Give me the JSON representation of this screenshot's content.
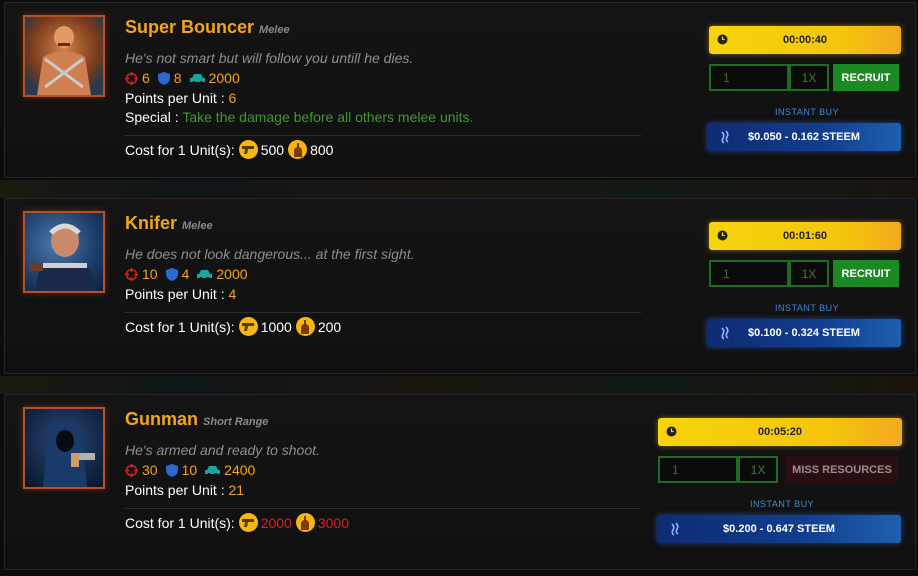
{
  "labels": {
    "points_per_unit": "Points per Unit :",
    "special": "Special :",
    "cost_for": "Cost for 1 Unit(s):",
    "instant_buy": "INSTANT BUY",
    "recruit": "RECRUIT",
    "miss_resources": "MISS RESOURCES",
    "quantity_placeholder": "1",
    "multiplier": "1X"
  },
  "icons": {
    "attack": "crosshair-icon",
    "defense": "shield-icon",
    "speed": "car-icon",
    "weapon_resource": "gun-icon",
    "alcohol_resource": "bottle-icon",
    "timer": "clock-icon",
    "currency": "steem-icon"
  },
  "colors": {
    "accent": "#f3a51b",
    "special": "#3c9a2c",
    "insufficient": "#e02020",
    "recruit": "#1c8a22"
  },
  "units": [
    {
      "name": "Super Bouncer",
      "type": "Melee",
      "description": "He's not smart but will follow you untill he dies.",
      "attack": "6",
      "defense": "8",
      "capacity": "2000",
      "points": "6",
      "special": "Take the damage before all others melee units.",
      "cost_weapons": "500",
      "cost_alcohol": "800",
      "weapons_insufficient": false,
      "alcohol_insufficient": false,
      "timer": "00:00:40",
      "steem_price": "$0.050 - 0.162 STEEM",
      "can_recruit": true
    },
    {
      "name": "Knifer",
      "type": "Melee",
      "description": "He does not look dangerous... at the first sight.",
      "attack": "10",
      "defense": "4",
      "capacity": "2000",
      "points": "4",
      "cost_weapons": "1000",
      "cost_alcohol": "200",
      "weapons_insufficient": false,
      "alcohol_insufficient": false,
      "timer": "00:01:60",
      "steem_price": "$0.100 - 0.324 STEEM",
      "can_recruit": true
    },
    {
      "name": "Gunman",
      "type": "Short Range",
      "description": "He's armed and ready to shoot.",
      "attack": "30",
      "defense": "10",
      "capacity": "2400",
      "points": "21",
      "cost_weapons": "2000",
      "cost_alcohol": "3000",
      "weapons_insufficient": true,
      "alcohol_insufficient": true,
      "timer": "00:05:20",
      "steem_price": "$0.200 - 0.647 STEEM",
      "can_recruit": false
    }
  ]
}
